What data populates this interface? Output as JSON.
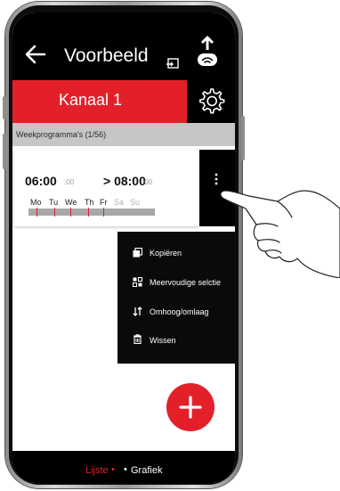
{
  "header": {
    "title": "Voorbeeld",
    "back_icon": "arrow-left-icon",
    "export_icon": "export-icon",
    "upload_icon": "cloud-upload-icon"
  },
  "channel": {
    "label": "Kanaal 1",
    "settings_icon": "gear-icon"
  },
  "section": {
    "label": "Weekprogramma's  (1/56)"
  },
  "program": {
    "start_time": "06:00",
    "start_seconds": ":00",
    "end_time": "> 08:00",
    "end_seconds": ":00",
    "days": [
      {
        "label": "Mo",
        "active": true
      },
      {
        "label": "Tu",
        "active": true
      },
      {
        "label": "We",
        "active": true
      },
      {
        "label": "Th",
        "active": true
      },
      {
        "label": "Fr",
        "active": true
      },
      {
        "label": "Sa",
        "active": false
      },
      {
        "label": "Su",
        "active": false
      }
    ]
  },
  "context_menu": {
    "items": [
      {
        "label": "Kopiëren",
        "icon": "copy-icon"
      },
      {
        "label": "Meervoudige selctie",
        "icon": "multi-select-icon"
      },
      {
        "label": "Omhoog/omlaag",
        "icon": "sort-arrows-icon"
      },
      {
        "label": "Wissen",
        "icon": "trash-icon"
      }
    ]
  },
  "fab": {
    "label": "+",
    "icon": "plus-icon"
  },
  "footer": {
    "list_label": "Lijste",
    "separator": "•",
    "graph_label": "Grafiek"
  },
  "colors": {
    "accent": "#e3202a",
    "header_bg": "#000000",
    "section_bg": "#c6c6c6"
  }
}
